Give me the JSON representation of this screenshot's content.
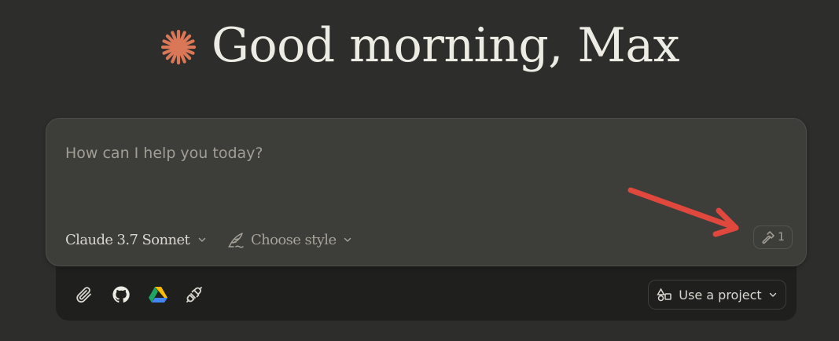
{
  "greeting": {
    "text": "Good morning, Max",
    "spark_icon": "claude-spark-icon",
    "spark_color": "#d97757"
  },
  "composer": {
    "placeholder": "How can I help you today?",
    "value": "",
    "model_label": "Claude 3.7 Sonnet",
    "style_label": "Choose style",
    "tools_count": "1",
    "annotation_arrow_color": "#e0483d"
  },
  "tray": {
    "icons": [
      "paperclip-icon",
      "github-icon",
      "google-drive-icon",
      "plug-icon"
    ],
    "project_label": "Use a project"
  },
  "colors": {
    "background": "#2d2d2b",
    "composer": "#3d3d3a",
    "tray": "#1f1f1e",
    "accent": "#d97757"
  }
}
